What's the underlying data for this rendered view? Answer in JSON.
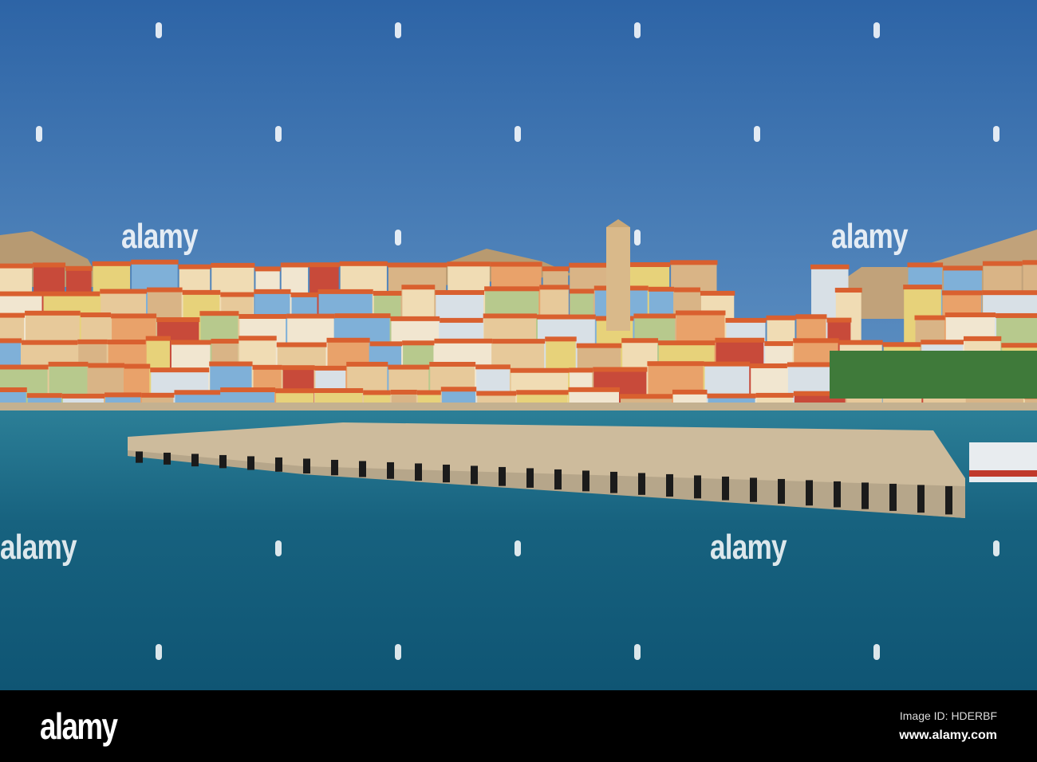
{
  "image": {
    "description_scene": "harbour",
    "colors": {
      "sky_top": "#2f67a8",
      "sky_bottom": "#5d8fc3",
      "water": "#1d6f8f",
      "pier": "#c9b89b"
    }
  },
  "watermark": {
    "text": "alamy"
  },
  "footer": {
    "logo": "alamy",
    "image_id": "Image ID: HDERBF",
    "url": "www.alamy.com"
  }
}
